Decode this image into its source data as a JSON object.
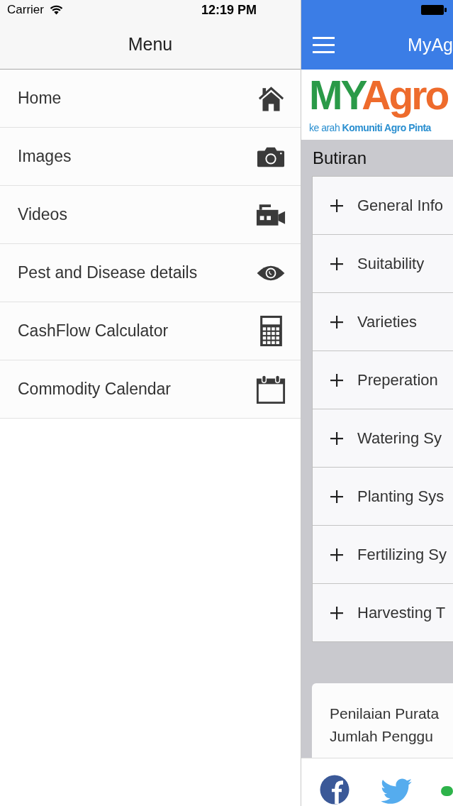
{
  "status_bar": {
    "carrier": "Carrier",
    "time": "12:19 PM"
  },
  "menu": {
    "title": "Menu",
    "items": [
      {
        "label": "Home"
      },
      {
        "label": "Images"
      },
      {
        "label": "Videos"
      },
      {
        "label": "Pest and Disease details"
      },
      {
        "label": "CashFlow Calculator"
      },
      {
        "label": "Commodity Calendar"
      }
    ]
  },
  "app": {
    "title": "MyAg",
    "logo": {
      "parts": [
        {
          "text": "MY",
          "color": "#2a9a48"
        },
        {
          "text": "Agro",
          "color": "#ee6b2c"
        }
      ],
      "tagline": "ke arah **Komuniti Agro Pinta**"
    },
    "section_title": "Butiran",
    "sections": [
      {
        "label": "General Info",
        "expanded": false
      },
      {
        "label": "Suitability",
        "expanded": false
      },
      {
        "label": "Varieties",
        "expanded": false
      },
      {
        "label": "Preperation",
        "expanded": false
      },
      {
        "label": "Watering Sy",
        "expanded": false
      },
      {
        "label": "Planting Sys",
        "expanded": false
      },
      {
        "label": "Fertilizing Sy",
        "expanded": false
      },
      {
        "label": "Harvesting T",
        "expanded": false
      }
    ],
    "rating_card": {
      "lines": [
        "Penilaian Purata",
        "Jumlah Penggu"
      ]
    }
  }
}
